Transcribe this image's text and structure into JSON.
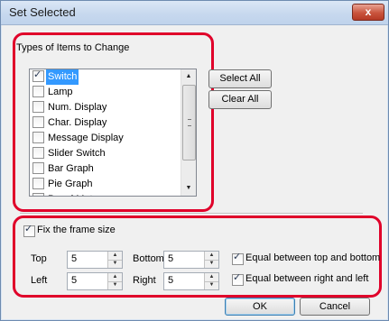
{
  "window": {
    "title": "Set Selected",
    "close_glyph": "x"
  },
  "types_group": {
    "label": "Types of Items to Change",
    "items": [
      {
        "label": "Switch",
        "checked": true,
        "selected": true
      },
      {
        "label": "Lamp",
        "checked": false,
        "selected": false
      },
      {
        "label": "Num. Display",
        "checked": false,
        "selected": false
      },
      {
        "label": "Char. Display",
        "checked": false,
        "selected": false
      },
      {
        "label": "Message Display",
        "checked": false,
        "selected": false
      },
      {
        "label": "Slider Switch",
        "checked": false,
        "selected": false
      },
      {
        "label": "Bar Graph",
        "checked": false,
        "selected": false
      },
      {
        "label": "Pie Graph",
        "checked": false,
        "selected": false
      },
      {
        "label": "Panel Meter",
        "checked": false,
        "selected": false
      }
    ],
    "select_all_label": "Select All",
    "clear_all_label": "Clear All"
  },
  "frame_size": {
    "fix_label": "Fix the frame size",
    "fix_checked": true,
    "top_label": "Top",
    "top_value": "5",
    "bottom_label": "Bottom",
    "bottom_value": "5",
    "left_label": "Left",
    "left_value": "5",
    "right_label": "Right",
    "right_value": "5",
    "equal_tb_label": "Equal between top and bottom",
    "equal_tb_checked": true,
    "equal_rl_label": "Equal between right and left",
    "equal_rl_checked": true
  },
  "footer": {
    "ok_label": "OK",
    "cancel_label": "Cancel"
  },
  "icons": {
    "scroll_up": "scroll-up-arrow-icon",
    "scroll_down": "scroll-down-arrow-icon",
    "spin_up": "spin-up-icon",
    "spin_down": "spin-down-icon"
  },
  "colors": {
    "highlight": "#e0002a",
    "selection": "#3399ff",
    "titlebar": "#c7d8ee"
  }
}
